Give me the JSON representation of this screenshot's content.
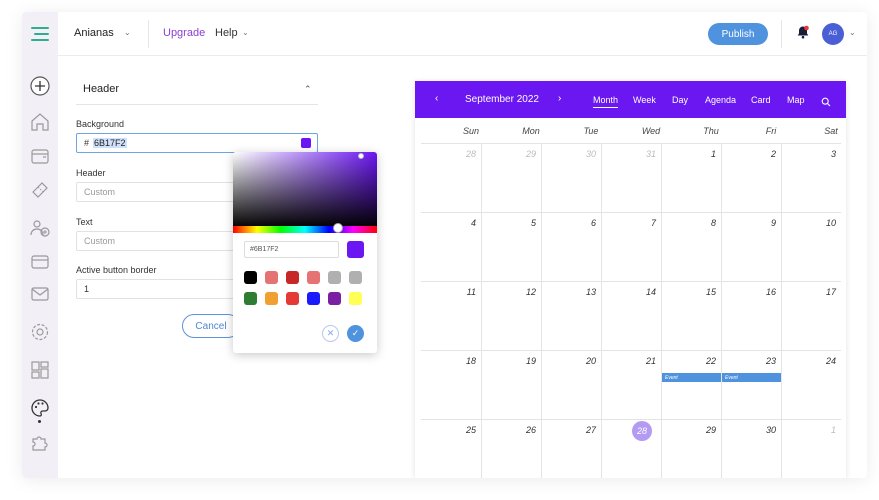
{
  "topbar": {
    "project_name": "Anianas",
    "upgrade": "Upgrade",
    "help": "Help",
    "publish": "Publish",
    "avatar_initials": "AG"
  },
  "panel": {
    "title": "Header",
    "background_label": "Background",
    "background_hash": "#",
    "background_value": "6B17F2",
    "header_label": "Header",
    "header_placeholder": "Custom",
    "text_label": "Text",
    "text_placeholder": "Custom",
    "border_label": "Active button border",
    "border_value": "1",
    "cancel": "Cancel"
  },
  "picker": {
    "hex_value": "#6B17F2",
    "selected_color": "#6B17F2",
    "swatches": [
      "#000000",
      "#e57373",
      "#c62828",
      "#e57373",
      "#b0b0b0",
      "#b0b0b0",
      "#2e7d32",
      "#f0a030",
      "#e53935",
      "#1a1aff",
      "#7b1fa2",
      "#ffff55"
    ]
  },
  "calendar": {
    "month_title": "September 2022",
    "views": [
      "Month",
      "Week",
      "Day",
      "Agenda",
      "Card",
      "Map"
    ],
    "active_view": "Month",
    "weekdays": [
      "Sun",
      "Mon",
      "Tue",
      "Wed",
      "Thu",
      "Fri",
      "Sat"
    ],
    "weeks": [
      [
        "28",
        "29",
        "30",
        "31",
        "1",
        "2",
        "3"
      ],
      [
        "4",
        "5",
        "6",
        "7",
        "8",
        "9",
        "10"
      ],
      [
        "11",
        "12",
        "13",
        "14",
        "15",
        "16",
        "17"
      ],
      [
        "18",
        "19",
        "20",
        "21",
        "22",
        "23",
        "24"
      ],
      [
        "25",
        "26",
        "27",
        "28",
        "29",
        "30",
        "1"
      ]
    ],
    "muted_cells": [
      "0-0",
      "0-1",
      "0-2",
      "0-3",
      "4-6"
    ],
    "today_cell": "4-3",
    "events": [
      {
        "label": "Event",
        "week": 3,
        "day": 4
      },
      {
        "label": "Event",
        "week": 3,
        "day": 5
      }
    ],
    "accent": "#6B17F2"
  }
}
